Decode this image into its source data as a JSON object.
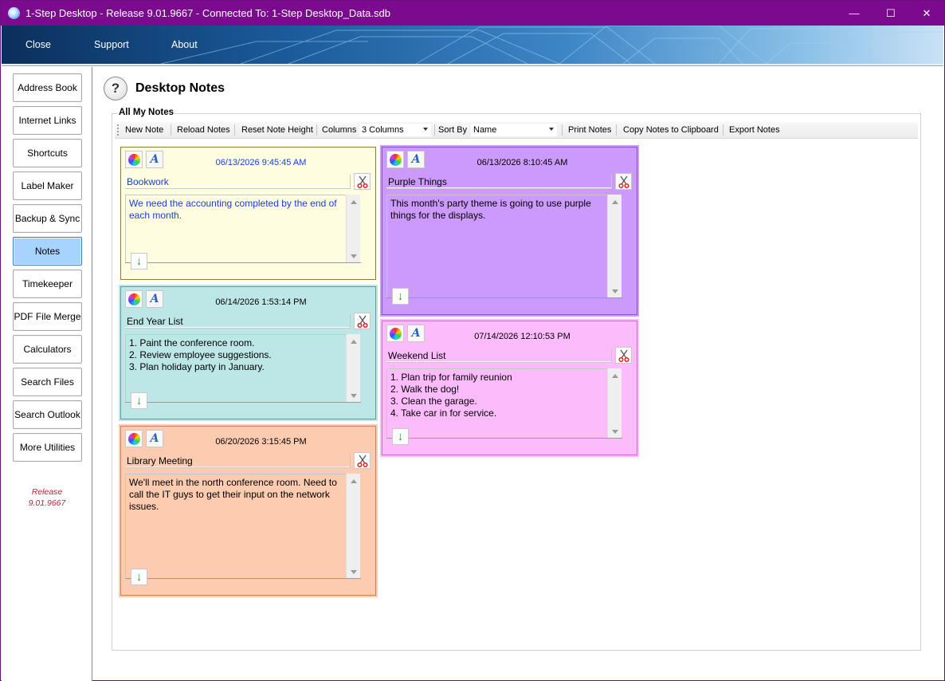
{
  "window": {
    "title": "1-Step Desktop - Release 9.01.9667 - Connected To: 1-Step Desktop_Data.sdb",
    "minimize": "—",
    "maximize": "☐",
    "close": "✕"
  },
  "menu": {
    "close": "Close",
    "support": "Support",
    "about": "About"
  },
  "sidebar": {
    "items": [
      {
        "label": "Address Book"
      },
      {
        "label": "Internet Links"
      },
      {
        "label": "Shortcuts"
      },
      {
        "label": "Label Maker"
      },
      {
        "label": "Backup & Sync"
      },
      {
        "label": "Notes",
        "active": true
      },
      {
        "label": "Timekeeper"
      },
      {
        "label": "PDF File Merge"
      },
      {
        "label": "Calculators"
      },
      {
        "label": "Search Files"
      },
      {
        "label": "Search Outlook"
      },
      {
        "label": "More Utilities"
      }
    ],
    "release_line1": "Release",
    "release_line2": "9.01.9667"
  },
  "page": {
    "help_icon": "?",
    "title": "Desktop Notes",
    "group_label": "All My Notes"
  },
  "toolbar": {
    "new_note": "New Note",
    "reload_notes": "Reload Notes",
    "reset_note_height": "Reset Note Height",
    "columns_label": "Columns",
    "columns_value": "3 Columns",
    "sort_by_label": "Sort By",
    "sort_by_value": "Name",
    "print_notes": "Print Notes",
    "copy_notes": "Copy Notes to Clipboard",
    "export_notes": "Export Notes"
  },
  "notes": [
    {
      "title": "Bookwork",
      "date": "06/13/2026 9:45:45 AM",
      "body": "We need the accounting completed by the end of each month.",
      "color": "#fefde0",
      "border": "#8c7c3c",
      "text_color": "#1a3fd6"
    },
    {
      "title": "End Year List",
      "date": "06/14/2026 1:53:14 PM",
      "body": "1. Paint the conference room.\n2. Review employee suggestions.\n3. Plan holiday party in January.",
      "color": "#bde7e6",
      "border": "#5a9fa3",
      "text_color": "#000000"
    },
    {
      "title": "Library Meeting",
      "date": "06/20/2026 3:15:45 PM",
      "body": "We'll meet in the north conference room.  Need to call the IT guys to get their input on the network issues.",
      "color": "#fccbb0",
      "border": "#c5845a",
      "text_color": "#000000"
    },
    {
      "title": "Purple Things",
      "date": "06/13/2026 8:10:45 AM",
      "body": "This month's party theme is going to use purple things for the displays.",
      "color": "#cc9afc",
      "border": "#8b53c4",
      "text_color": "#000000"
    },
    {
      "title": "Weekend List",
      "date": "07/14/2026 12:10:53 PM",
      "body": "1. Plan trip for family reunion\n2. Walk the dog!\n3. Clean the garage.\n4. Take car in for service.",
      "color": "#fcbcfc",
      "border": "#cc6ccc",
      "text_color": "#000000"
    }
  ],
  "icons": {
    "color_picker": "color-wheel-icon",
    "font_picker": "font-icon",
    "cut": "scissors-icon",
    "expand": "↓"
  }
}
